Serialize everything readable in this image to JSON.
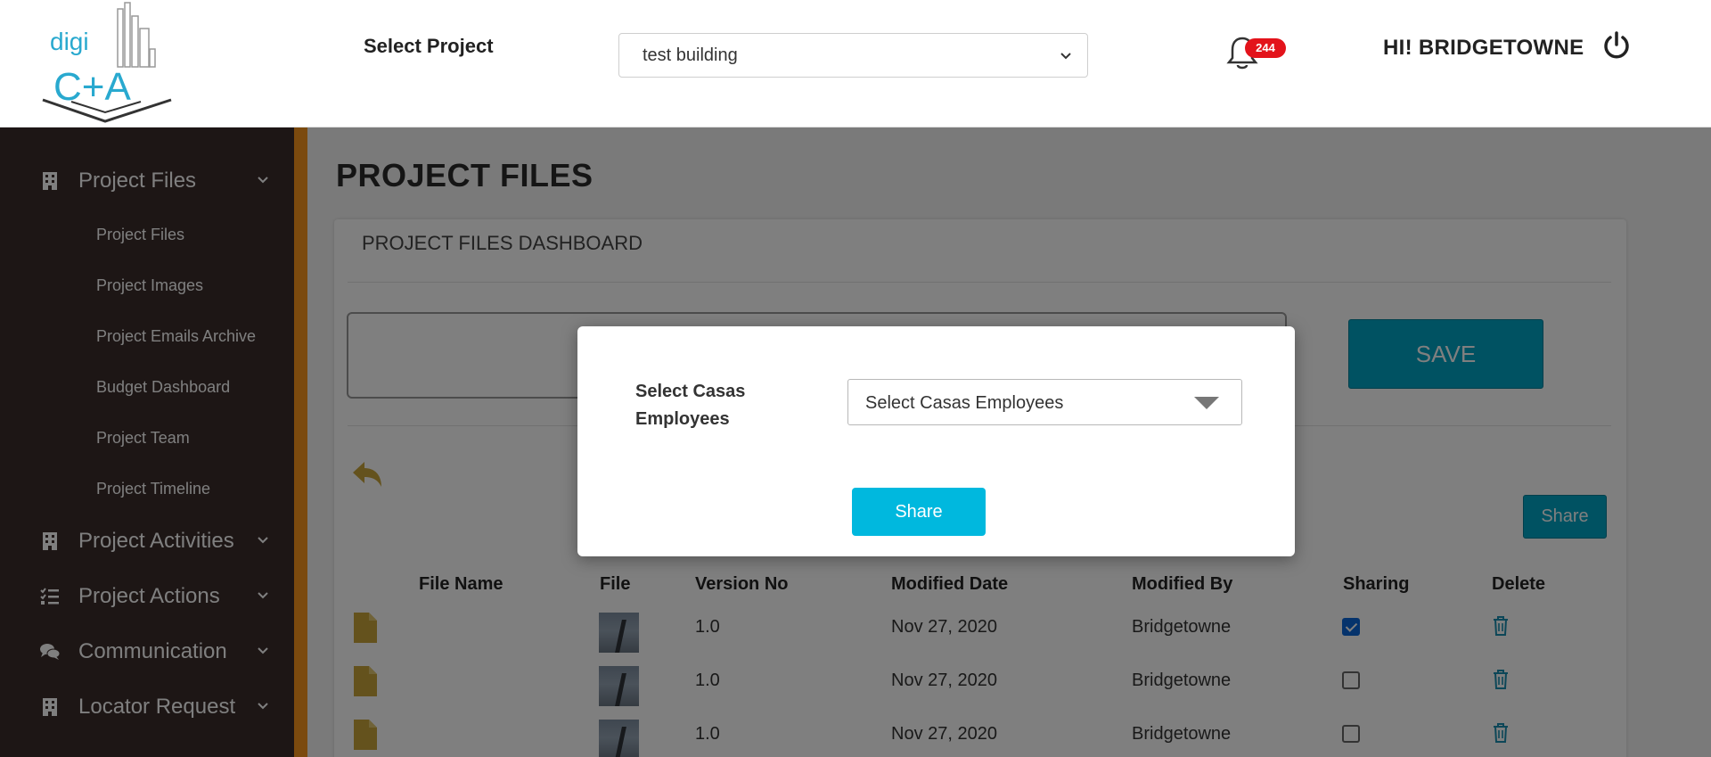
{
  "header": {
    "logo_text_top": "digi",
    "logo_text_bottom": "C+A",
    "select_project_label": "Select Project",
    "project_select_value": "test building",
    "notification_count": "244",
    "greeting": "HI! BRIDGETOWNE"
  },
  "sidebar": {
    "groups": [
      {
        "label": "Project Files",
        "icon": "building-icon"
      },
      {
        "label": "Project Activities",
        "icon": "building-icon"
      },
      {
        "label": "Project Actions",
        "icon": "list-check-icon"
      },
      {
        "label": "Communication",
        "icon": "chat-icon"
      },
      {
        "label": "Locator Request",
        "icon": "building-icon"
      }
    ],
    "sub_items": [
      "Project Files",
      "Project Images",
      "Project Emails Archive",
      "Budget Dashboard",
      "Project Team",
      "Project Timeline"
    ]
  },
  "main": {
    "page_title": "PROJECT FILES",
    "card_title": "PROJECT FILES DASHBOARD",
    "save_label": "SAVE",
    "share_label": "Share",
    "table": {
      "headers": [
        "File Name",
        "File",
        "Version No",
        "Modified Date",
        "Modified By",
        "Sharing",
        "Delete"
      ],
      "rows": [
        {
          "version": "1.0",
          "date": "Nov 27, 2020",
          "by": "Bridgetowne",
          "shared": true
        },
        {
          "version": "1.0",
          "date": "Nov 27, 2020",
          "by": "Bridgetowne",
          "shared": false
        },
        {
          "version": "1.0",
          "date": "Nov 27, 2020",
          "by": "Bridgetowne",
          "shared": false
        }
      ]
    }
  },
  "modal": {
    "label_line1": "Select Casas",
    "label_line2": "Employees",
    "select_placeholder": "Select Casas Employees",
    "share_label": "Share"
  },
  "colors": {
    "sidebar_bg": "#3a2d2b",
    "accent_orange": "#f7941d",
    "button_blue": "#00a4c4",
    "badge_red": "#e3131b"
  }
}
